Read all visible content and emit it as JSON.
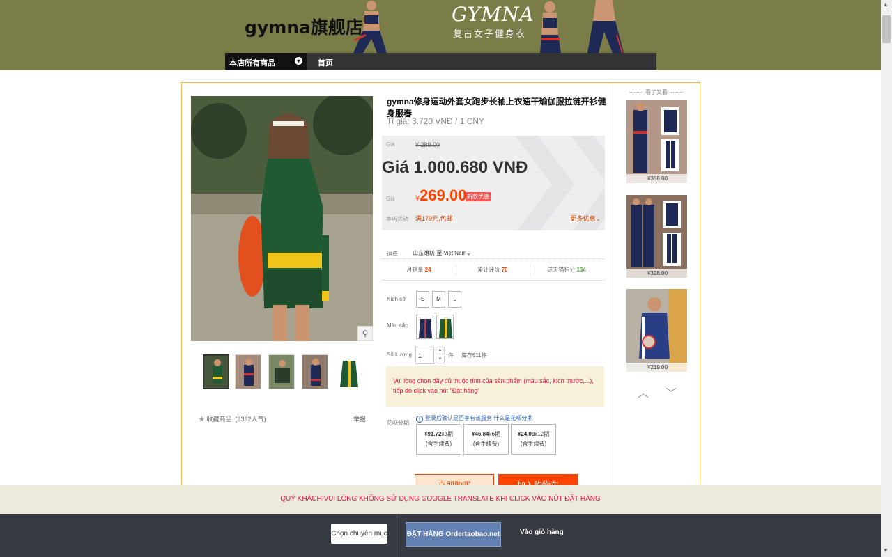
{
  "header": {
    "store_name": "gymna旗舰店",
    "brand": "GYMNA",
    "brand_sub": "复古女子健身衣",
    "nav_all": "本店所有商品",
    "nav_home": "首页"
  },
  "product": {
    "title": "gymna修身运动外套女跑步长袖上衣速干瑜伽服拉链开衫健身服春",
    "exchange_rate": "Tỉ giá: 3.720 VNĐ / 1 CNY",
    "original_label": "Giá",
    "original_price": "¥ 289.00",
    "vnd_price": "Giá  1.000.680 VNĐ",
    "promo_label": "Giá",
    "promo_symbol": "¥",
    "promo_price": "269.00",
    "promo_tag": "新款优惠",
    "shop_activity_label": "本店活动",
    "shop_activity": "满179元,包邮",
    "more_offers": "更多优惠",
    "shipping_label": "运费",
    "shipping": "山东潍坊 至 Việt Nam",
    "stats": [
      {
        "label": "月销量",
        "value": "24",
        "color": "red"
      },
      {
        "label": "累计评价",
        "value": "78",
        "color": "red"
      },
      {
        "label": "送天猫积分",
        "value": "134",
        "color": "grn"
      }
    ],
    "size_label": "Kích cỡ",
    "sizes": [
      "S",
      "M",
      "L"
    ],
    "color_label": "Màu sắc",
    "qty_label": "Số Lượng",
    "qty_value": "1",
    "qty_unit": "件",
    "stock": "库存611件",
    "notice": "Vui lòng chọn đầy đủ thuộc tính của sản phẩm (màu sắc, kích thước,...), tiếp đó click vào nút \"Đặt hàng\"",
    "huabei_label": "花呗分期",
    "huabei_info": "登录后确认是否享有该服务",
    "huabei_link": "什么是花呗分期",
    "installments": [
      {
        "price": "¥91.72",
        "periods": "x3期",
        "fee": "(含手续费)"
      },
      {
        "price": "¥46.84",
        "periods": "x6期",
        "fee": "(含手续费)"
      },
      {
        "price": "¥24.09",
        "periods": "x12期",
        "fee": "(含手续费)"
      }
    ],
    "buy_now": "立即购买",
    "add_cart": "加入购物车",
    "favorite": "收藏商品",
    "favorite_count": "(9392人气)",
    "report": "举报"
  },
  "sidebar": {
    "title": "看了又看",
    "items": [
      {
        "price": "¥358.00"
      },
      {
        "price": "¥328.00"
      },
      {
        "price": "¥219.00"
      }
    ]
  },
  "bottom": {
    "warning": "QUÝ KHÁCH VUI LÒNG KHÔNG SỬ DỤNG GOOGLE TRANSLATE KHI CLICK VÀO NÚT ĐẶT HÀNG",
    "choose_category": "Chọn chuyên mục",
    "order": "ĐẶT HÀNG Ordertaobao.net",
    "cart": "Vào giỏ hàng"
  },
  "colors": {
    "banner": "#7b7d49",
    "accent": "#ff4400",
    "box_border": "#f5b553",
    "action_bar": "#373a42",
    "order_button": "#6381b3"
  }
}
